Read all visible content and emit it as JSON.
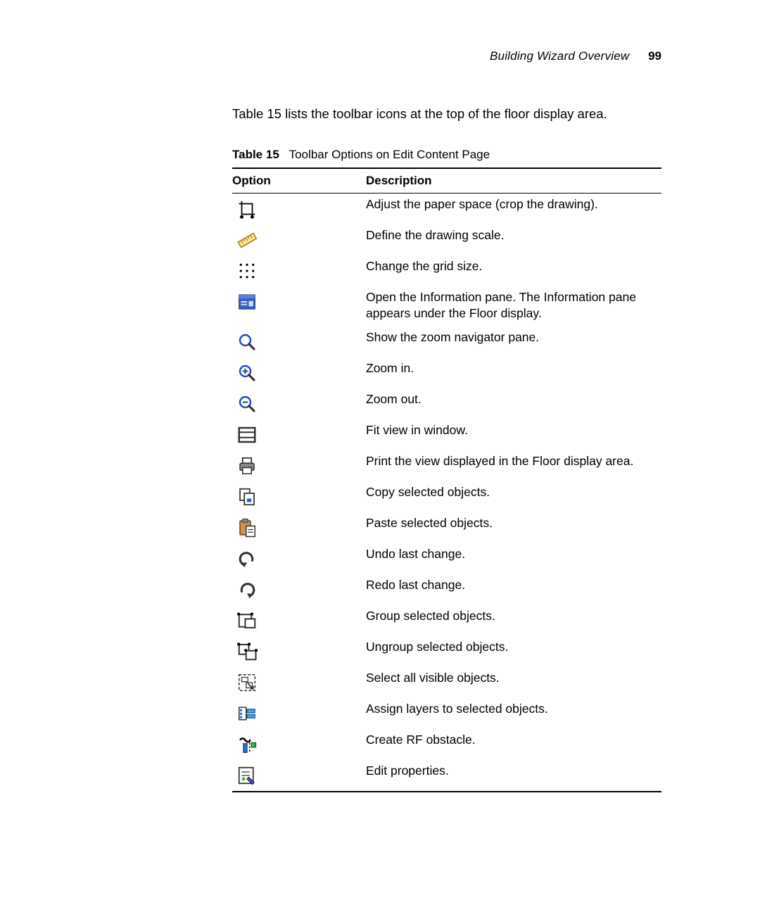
{
  "header": {
    "section": "Building Wizard Overview",
    "page": "99"
  },
  "intro": "Table 15 lists the toolbar icons at the top of the floor display area.",
  "table": {
    "caption_label": "Table 15",
    "caption_text": "Toolbar Options on Edit Content Page",
    "col_option": "Option",
    "col_description": "Description",
    "rows": {
      "crop": "Adjust the paper space (crop the drawing).",
      "scale": "Define the drawing scale.",
      "grid": "Change the grid size.",
      "info": "Open the Information pane. The Information pane appears under the Floor display.",
      "zoomnav": "Show the zoom navigator pane.",
      "zoomin": "Zoom in.",
      "zoomout": "Zoom out.",
      "fit": "Fit view in window.",
      "print": "Print the view displayed in the Floor display area.",
      "copy": "Copy selected objects.",
      "paste": "Paste selected objects.",
      "undo": "Undo last change.",
      "redo": "Redo last change.",
      "group": "Group selected objects.",
      "ungroup": "Ungroup selected objects.",
      "selectall": "Select all visible objects.",
      "layers": "Assign layers to selected objects.",
      "rfobstacle": "Create RF obstacle.",
      "editprops": "Edit properties."
    }
  }
}
